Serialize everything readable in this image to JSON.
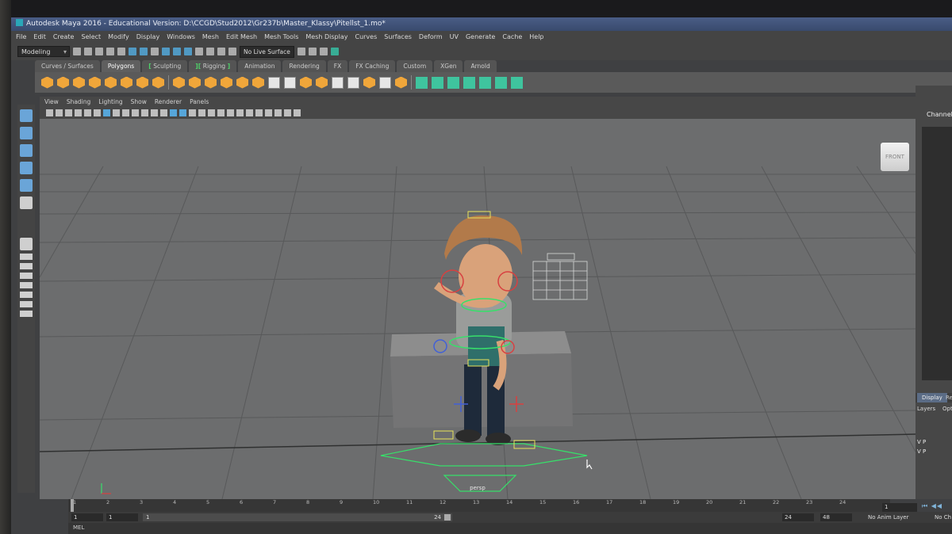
{
  "window": {
    "title": "Autodesk Maya 2016 - Educational Version: D:\\CCGD\\Stud2012\\Gr237b\\Master_Klassy\\Pitellst_1.mo*"
  },
  "menus": [
    "File",
    "Edit",
    "Create",
    "Select",
    "Modify",
    "Display",
    "Windows",
    "Mesh",
    "Edit Mesh",
    "Mesh Tools",
    "Mesh Display",
    "Curves",
    "Surfaces",
    "Deform",
    "UV",
    "Generate",
    "Cache",
    "Help"
  ],
  "status_line": {
    "mode": "Modeling",
    "live_surface": "No Live Surface"
  },
  "shelf_tabs": [
    {
      "label": "Curves / Surfaces",
      "active": false
    },
    {
      "label": "Polygons",
      "active": true
    },
    {
      "label": "Sculpting",
      "active": false,
      "bracket": "left"
    },
    {
      "label": "Rigging",
      "active": false,
      "bracket": "both"
    },
    {
      "label": "Animation",
      "active": false
    },
    {
      "label": "Rendering",
      "active": false
    },
    {
      "label": "FX",
      "active": false
    },
    {
      "label": "FX Caching",
      "active": false
    },
    {
      "label": "Custom",
      "active": false
    },
    {
      "label": "XGen",
      "active": false
    },
    {
      "label": "Arnold",
      "active": false
    }
  ],
  "viewport": {
    "menus": [
      "View",
      "Shading",
      "Lighting",
      "Show",
      "Renderer",
      "Panels"
    ],
    "viewcube_label": "FRONT",
    "camera": "persp"
  },
  "right_panel": {
    "tab_top": "Channel",
    "layer_tabs": {
      "display": "Display",
      "render": "Ren"
    },
    "layers_label": "Layers",
    "options_label": "Options",
    "layer_rows": [
      "V P",
      "V P"
    ]
  },
  "timeline": {
    "ticks": [
      "1",
      "2",
      "3",
      "4",
      "5",
      "6",
      "7",
      "8",
      "9",
      "10",
      "11",
      "12",
      "13",
      "14",
      "15",
      "16",
      "17",
      "18",
      "19",
      "20",
      "21",
      "22",
      "23",
      "24"
    ],
    "current_frame": "1"
  },
  "range": {
    "start": "1",
    "playback_start": "1",
    "slider_start": "1",
    "slider_end": "24",
    "playback_end": "24",
    "end": "48",
    "anim_layer": "No Anim Layer",
    "char_set": "No Ch"
  },
  "command_line": {
    "label": "MEL"
  },
  "colors": {
    "viewport_bg": "#6c6d6e",
    "grid_line": "#565758",
    "accent_blue": "#52a8d9",
    "rig_green": "#37e06a",
    "rig_yellow": "#e8e25a"
  }
}
